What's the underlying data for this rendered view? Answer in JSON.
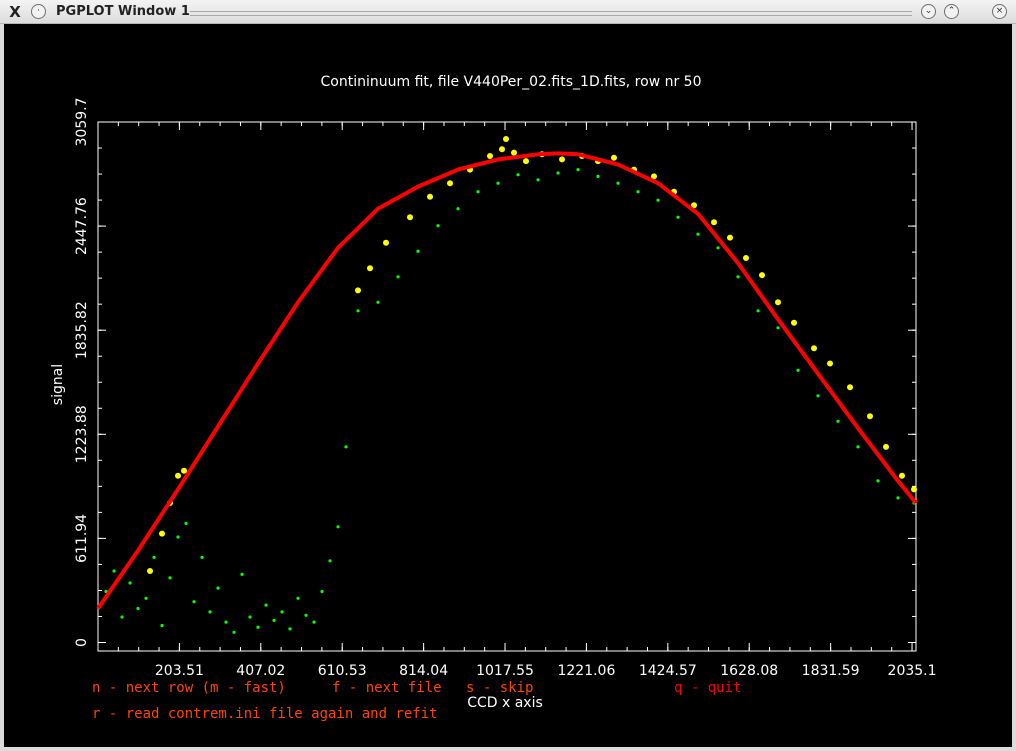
{
  "window": {
    "title": "PGPLOT Window 1",
    "app_icon": "X",
    "minimize_glyph": "⌄",
    "maximize_glyph": "⌃",
    "close_glyph": "×"
  },
  "colors": {
    "plot_background": "#000000",
    "axes": "#ffffff",
    "fit_curve": "#ff0000",
    "continuum_points": "#ffff00",
    "spectrum_points": "#00ff00",
    "menu_text": "#ff4500",
    "menu_quit": "#ff0000"
  },
  "menu": {
    "next_row": "n - next row (m - fast)",
    "next_file": "f - next file",
    "skip": "s - skip",
    "quit": "q - quit",
    "reread": "r - read contrem.ini file again and refit"
  },
  "chart_data": {
    "type": "scatter",
    "title": "Contininuum fit, file V440Per_02.fits_1D.fits, row nr 50",
    "xlabel": "CCD x axis",
    "ylabel": "signal",
    "xlim": [
      0,
      2045
    ],
    "ylim": [
      -50,
      3059.7
    ],
    "x_ticks": [
      203.51,
      407.02,
      610.53,
      814.04,
      1017.55,
      1221.06,
      1424.57,
      1628.08,
      1831.59,
      2035.1
    ],
    "x_tick_labels": [
      "203.51",
      "407.02",
      "610.53",
      "814.04",
      "1017.55",
      "1221.06",
      "1424.57",
      "1628.08",
      "1831.59",
      "2035.1"
    ],
    "y_ticks": [
      0,
      611.94,
      1223.88,
      1835.82,
      2447.76,
      3059.7
    ],
    "y_tick_labels": [
      "0",
      "611.94",
      "1223.88",
      "1835.82",
      "2447.76",
      "3059.7"
    ],
    "grid": false,
    "series": [
      {
        "kind": "fit_curve",
        "x": [
          0,
          100,
          200,
          300,
          400,
          500,
          600,
          700,
          800,
          900,
          1000,
          1100,
          1150,
          1200,
          1300,
          1400,
          1500,
          1600,
          1700,
          1800,
          1900,
          2000,
          2045
        ],
        "y": [
          200,
          540,
          900,
          1270,
          1640,
          2000,
          2320,
          2550,
          2680,
          2780,
          2840,
          2870,
          2875,
          2870,
          2810,
          2700,
          2520,
          2230,
          1900,
          1580,
          1260,
          950,
          820
        ]
      },
      {
        "kind": "continuum_points",
        "x": [
          130,
          160,
          180,
          200,
          215,
          650,
          680,
          720,
          780,
          830,
          880,
          930,
          980,
          1010,
          1020,
          1040,
          1070,
          1110,
          1160,
          1210,
          1250,
          1290,
          1340,
          1390,
          1440,
          1490,
          1540,
          1580,
          1620,
          1660,
          1700,
          1740,
          1790,
          1830,
          1880,
          1930,
          1970,
          2010,
          2040
        ],
        "y": [
          420,
          640,
          820,
          980,
          1010,
          2070,
          2200,
          2350,
          2500,
          2620,
          2700,
          2780,
          2860,
          2900,
          2960,
          2880,
          2830,
          2870,
          2840,
          2860,
          2830,
          2850,
          2780,
          2740,
          2650,
          2570,
          2470,
          2380,
          2260,
          2160,
          2000,
          1880,
          1730,
          1640,
          1500,
          1330,
          1150,
          980,
          900
        ]
      },
      {
        "kind": "spectrum_points",
        "x": [
          20,
          40,
          60,
          80,
          100,
          120,
          140,
          160,
          180,
          200,
          220,
          240,
          260,
          280,
          300,
          320,
          340,
          360,
          380,
          400,
          420,
          440,
          460,
          480,
          500,
          520,
          540,
          560,
          580,
          600,
          620,
          650,
          700,
          750,
          800,
          850,
          900,
          950,
          1000,
          1050,
          1100,
          1150,
          1200,
          1250,
          1300,
          1350,
          1400,
          1450,
          1500,
          1550,
          1600,
          1650,
          1700,
          1750,
          1800,
          1850,
          1900,
          1950,
          2000,
          2040
        ],
        "y": [
          300,
          420,
          150,
          350,
          200,
          260,
          500,
          100,
          380,
          620,
          700,
          240,
          500,
          180,
          320,
          120,
          60,
          400,
          150,
          90,
          220,
          130,
          180,
          80,
          260,
          160,
          120,
          300,
          480,
          680,
          1150,
          1950,
          2000,
          2150,
          2300,
          2450,
          2550,
          2650,
          2700,
          2750,
          2720,
          2760,
          2780,
          2740,
          2700,
          2650,
          2600,
          2500,
          2400,
          2320,
          2150,
          1950,
          1850,
          1600,
          1450,
          1300,
          1150,
          950,
          850,
          820
        ]
      }
    ]
  }
}
